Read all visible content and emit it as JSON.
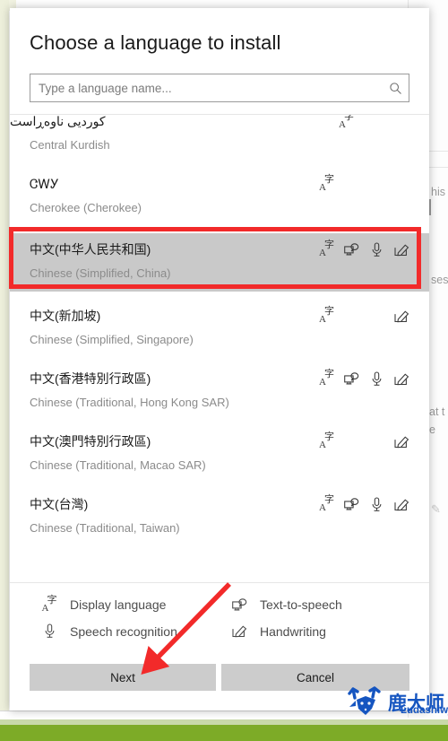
{
  "dialog": {
    "title": "Choose a language to install",
    "search": {
      "placeholder": "Type a language name...",
      "value": "",
      "icon": "search-icon"
    },
    "languages": [
      {
        "native": "کوردیی ناوەڕاست",
        "english": "Central Kurdish",
        "rtl": true,
        "partial": true,
        "selected": false,
        "capabilities": [
          "display-language"
        ]
      },
      {
        "native": "ᏣᎳᎩ",
        "english": "Cherokee (Cherokee)",
        "rtl": false,
        "partial": false,
        "selected": false,
        "capabilities": [
          "display-language"
        ]
      },
      {
        "native": "中文(中华人民共和国)",
        "english": "Chinese (Simplified, China)",
        "rtl": false,
        "partial": false,
        "selected": true,
        "capabilities": [
          "display-language",
          "text-to-speech",
          "speech-recognition",
          "handwriting"
        ]
      },
      {
        "native": "中文(新加坡)",
        "english": "Chinese (Simplified, Singapore)",
        "rtl": false,
        "partial": false,
        "selected": false,
        "capabilities": [
          "display-language",
          "handwriting"
        ]
      },
      {
        "native": "中文(香港特別行政區)",
        "english": "Chinese (Traditional, Hong Kong SAR)",
        "rtl": false,
        "partial": false,
        "selected": false,
        "capabilities": [
          "display-language",
          "text-to-speech",
          "speech-recognition",
          "handwriting"
        ]
      },
      {
        "native": "中文(澳門特別行政區)",
        "english": "Chinese (Traditional, Macao SAR)",
        "rtl": false,
        "partial": false,
        "selected": false,
        "capabilities": [
          "display-language",
          "handwriting"
        ]
      },
      {
        "native": "中文(台灣)",
        "english": "Chinese (Traditional, Taiwan)",
        "rtl": false,
        "partial": false,
        "selected": false,
        "capabilities": [
          "display-language",
          "text-to-speech",
          "speech-recognition",
          "handwriting"
        ]
      }
    ],
    "legend": [
      {
        "icon": "display-language-icon",
        "label": "Display language"
      },
      {
        "icon": "text-to-speech-icon",
        "label": "Text-to-speech"
      },
      {
        "icon": "speech-recognition-icon",
        "label": "Speech recognition"
      },
      {
        "icon": "handwriting-icon",
        "label": "Handwriting"
      }
    ],
    "buttons": {
      "next": "Next",
      "cancel": "Cancel"
    }
  },
  "background": {
    "fragments": [
      "his",
      "ses",
      "at t",
      "e"
    ]
  },
  "annotations": {
    "highlight_color": "#f22a2a",
    "arrow_color": "#f22a2a"
  },
  "watermark": {
    "cn": "鹿大师",
    "url": "Ludashiwj.com"
  },
  "colors": {
    "selection": "#c9c9c9",
    "button": "#cccccc",
    "accent_red": "#f22a2a",
    "bottom_bar_green": "#7dab27"
  }
}
